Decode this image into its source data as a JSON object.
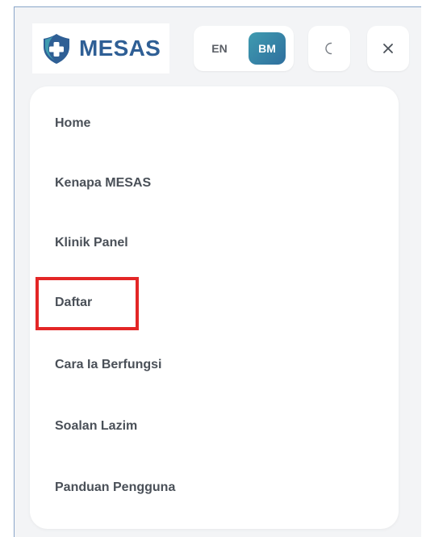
{
  "brand": {
    "name": "MESAS",
    "logo_icon": "shield-medical-cross-icon",
    "color": "#2f5f95"
  },
  "language": {
    "options": [
      "EN",
      "BM"
    ],
    "selected": "BM"
  },
  "controls": {
    "theme_icon": "moon-icon",
    "close_icon": "close-icon"
  },
  "menu": {
    "items": [
      {
        "label": "Home"
      },
      {
        "label": "Kenapa MESAS"
      },
      {
        "label": "Klinik Panel"
      },
      {
        "label": "Daftar",
        "highlighted": true
      },
      {
        "label": "Cara Ia Berfungsi"
      },
      {
        "label": "Soalan Lazim"
      },
      {
        "label": "Panduan Pengguna"
      }
    ]
  },
  "colors": {
    "accent": "#2f6f9e",
    "highlight_box": "#e32626"
  }
}
